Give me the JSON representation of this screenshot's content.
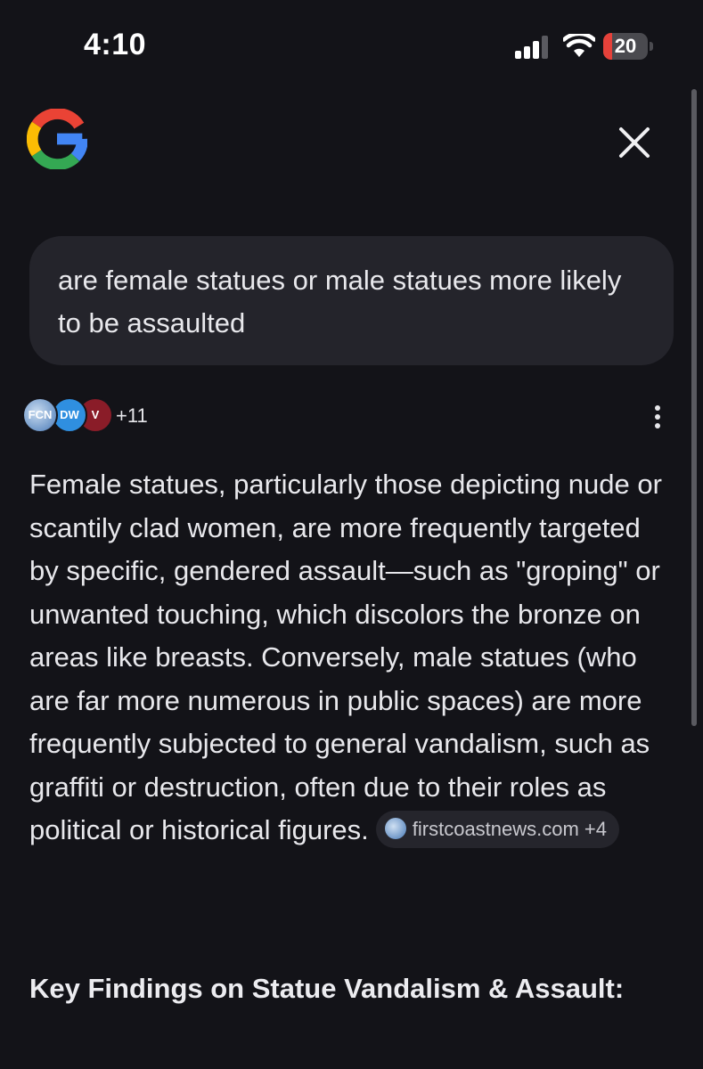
{
  "status_bar": {
    "time": "4:10",
    "battery_percent": "20",
    "battery_level": 0.2,
    "signal_bars": 3,
    "icons": [
      "cellular-signal-icon",
      "wifi-icon",
      "battery-icon"
    ]
  },
  "header": {
    "logo": "google-g-logo",
    "close_icon": "close-icon"
  },
  "query": {
    "text": "are female statues or male statues more likely to be assaulted"
  },
  "sources": {
    "count_label": "+11",
    "avatars": [
      {
        "icon": "source-avatar-1",
        "text": "FCN",
        "color": "#6f97c8"
      },
      {
        "icon": "source-avatar-dw",
        "text": "DW",
        "color": "#2f8fe0"
      },
      {
        "icon": "source-avatar-vice",
        "text": "V",
        "color": "#8a1c28"
      }
    ],
    "more_icon": "more-vert-icon"
  },
  "answer": {
    "paragraph": "Female statues, particularly those depicting nude or scantily clad women, are more frequently targeted by specific, gendered assault—such as \"groping\" or unwanted touching, which discolors the bronze on areas like breasts. Conversely, male statues (who are far more numerous in public spaces) are more frequently subjected to general vandalism, such as graffiti or destruction, often due to their roles as political or historical figures.",
    "citation": "firstcoastnews.com +4"
  },
  "section": {
    "heading": "Key Findings on Statue Vandalism & Assault:"
  },
  "colors": {
    "background": "#131318",
    "bubble": "#24242b",
    "text": "#e8e8ec",
    "battery_low": "#e5413a"
  }
}
